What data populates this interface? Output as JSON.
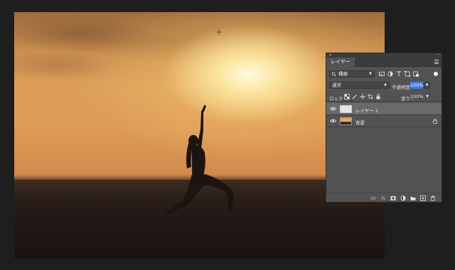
{
  "colors": {
    "app_background": "#1e1e1e",
    "panel_background": "#535353",
    "panel_header": "#3c3c3c",
    "selection_highlight": "#3b7ce0",
    "selected_layer_row": "#6a6a6a"
  },
  "canvas": {
    "description": "sunset yoga silhouette photo"
  },
  "layers_panel": {
    "tab_label": "レイヤー",
    "filter": {
      "kind_label": "種類",
      "icons": [
        "pixel-filter-icon",
        "adjustment-filter-icon",
        "type-filter-icon",
        "shape-filter-icon",
        "smart-object-filter-icon"
      ]
    },
    "blend_mode": "通常",
    "opacity_label": "不透明度 :",
    "opacity_value": "100%",
    "lock_label": "ロック :",
    "fill_label": "塗り :",
    "fill_value": "100%",
    "layers": [
      {
        "name": "レイヤー 1",
        "visible": true,
        "selected": true,
        "thumbnail": "transparent"
      },
      {
        "name": "背景",
        "visible": true,
        "selected": false,
        "thumbnail": "photo",
        "locked": true
      }
    ],
    "footer_icons": [
      "link-layers-icon",
      "fx-icon",
      "add-mask-icon",
      "adjustment-layer-icon",
      "new-group-icon",
      "new-layer-icon",
      "trash-icon"
    ]
  }
}
